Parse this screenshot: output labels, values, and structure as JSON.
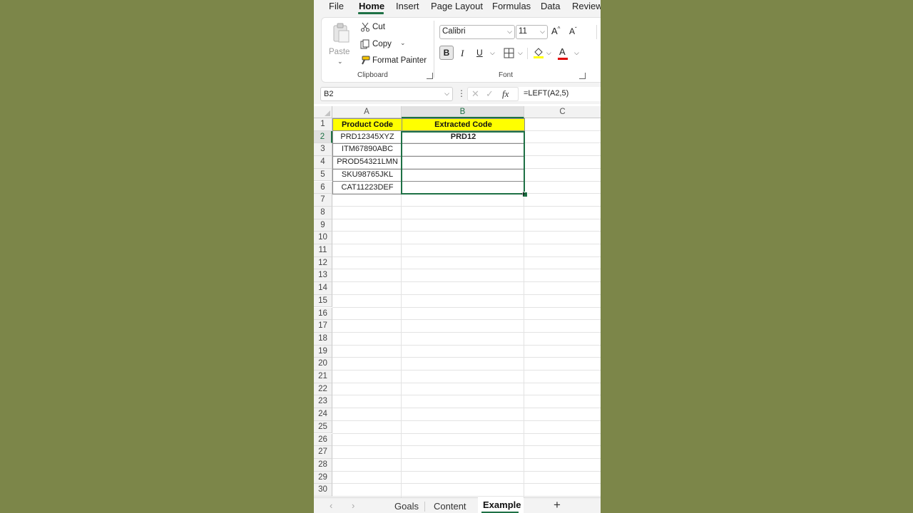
{
  "menu": {
    "tabs": [
      "File",
      "Home",
      "Insert",
      "Page Layout",
      "Formulas",
      "Data",
      "Review"
    ],
    "active": "Home"
  },
  "ribbon": {
    "clipboard": {
      "paste_label": "Paste",
      "cut_label": "Cut",
      "copy_label": "Copy",
      "format_painter_label": "Format Painter",
      "group_label": "Clipboard"
    },
    "font": {
      "font_name": "Calibri",
      "font_size": "11",
      "increase_label": "A",
      "decrease_label": "A",
      "bold_label": "B",
      "italic_label": "I",
      "underline_label": "U",
      "font_color_letter": "A",
      "group_label": "Font",
      "highlight_color": "#ffff00",
      "font_color": "#e00000"
    }
  },
  "formula_bar": {
    "name_box": "B2",
    "fx_label": "fx",
    "formula": "=LEFT(A2,5)"
  },
  "sheet": {
    "columns": [
      "A",
      "B",
      "C"
    ],
    "selected_column": "B",
    "rows": [
      "1",
      "2",
      "3",
      "4",
      "5",
      "6",
      "7",
      "8",
      "9",
      "10",
      "11",
      "12",
      "13",
      "14",
      "15",
      "16",
      "17",
      "18",
      "19",
      "20",
      "21",
      "22",
      "23",
      "24",
      "25",
      "26",
      "27",
      "28",
      "29",
      "30"
    ],
    "selected_row": "2",
    "header": {
      "a": "Product Code",
      "b": "Extracted Code"
    },
    "data": [
      {
        "a": "PRD12345XYZ",
        "b": "PRD12"
      },
      {
        "a": "ITM67890ABC",
        "b": ""
      },
      {
        "a": "PROD54321LMN",
        "b": ""
      },
      {
        "a": "SKU98765JKL",
        "b": ""
      },
      {
        "a": "CAT11223DEF",
        "b": ""
      }
    ],
    "header_fill": "#ffff00",
    "accent": "#1e7145"
  },
  "sheet_tabs": {
    "tabs": [
      "Goals",
      "Content",
      "Example"
    ],
    "active": "Example",
    "add_label": "+"
  }
}
